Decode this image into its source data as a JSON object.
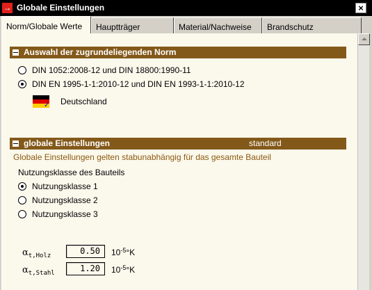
{
  "window": {
    "title": "Globale Einstellungen",
    "close_glyph": "×",
    "icon_glyph": "→"
  },
  "tabs": [
    {
      "label": "Norm/Globale Werte",
      "active": true
    },
    {
      "label": "Hauptträger",
      "active": false
    },
    {
      "label": "Material/Nachweise",
      "active": false
    },
    {
      "label": "Brandschutz",
      "active": false
    }
  ],
  "norm_section": {
    "title": "Auswahl der zugrundeliegenden Norm",
    "options": [
      {
        "label": "DIN 1052:2008-12 und DIN 18800:1990-11",
        "selected": false
      },
      {
        "label": "DIN EN 1995-1-1:2010-12 und DIN EN 1993-1-1:2010-12",
        "selected": true
      }
    ],
    "country": "Deutschland",
    "country_icon": "german-flag-icon"
  },
  "global_section": {
    "title": "globale Einstellungen",
    "mode": "standard",
    "note": "Globale Einstellungen gelten stabunabhängig für das gesamte Bauteil",
    "usage_class_label": "Nutzungsklasse des Bauteils",
    "usage_classes": [
      {
        "label": "Nutzungsklasse 1",
        "selected": true
      },
      {
        "label": "Nutzungsklasse 2",
        "selected": false
      },
      {
        "label": "Nutzungsklasse 3",
        "selected": false
      }
    ]
  },
  "params": {
    "alpha_holz": {
      "symbol": "α",
      "subscript": "t,Holz",
      "value": "0.50",
      "unit_base": "10",
      "unit_exp": "-5",
      "unit_suffix": "°K"
    },
    "alpha_stahl": {
      "symbol": "α",
      "subscript": "t,Stahl",
      "value": "1.20",
      "unit_base": "10",
      "unit_exp": "-5",
      "unit_suffix": "°K"
    }
  },
  "colors": {
    "section_header": "#83591a",
    "note_text": "#8a5a10",
    "panel_bg": "#fbf8ec",
    "titlebar": "#000000"
  }
}
